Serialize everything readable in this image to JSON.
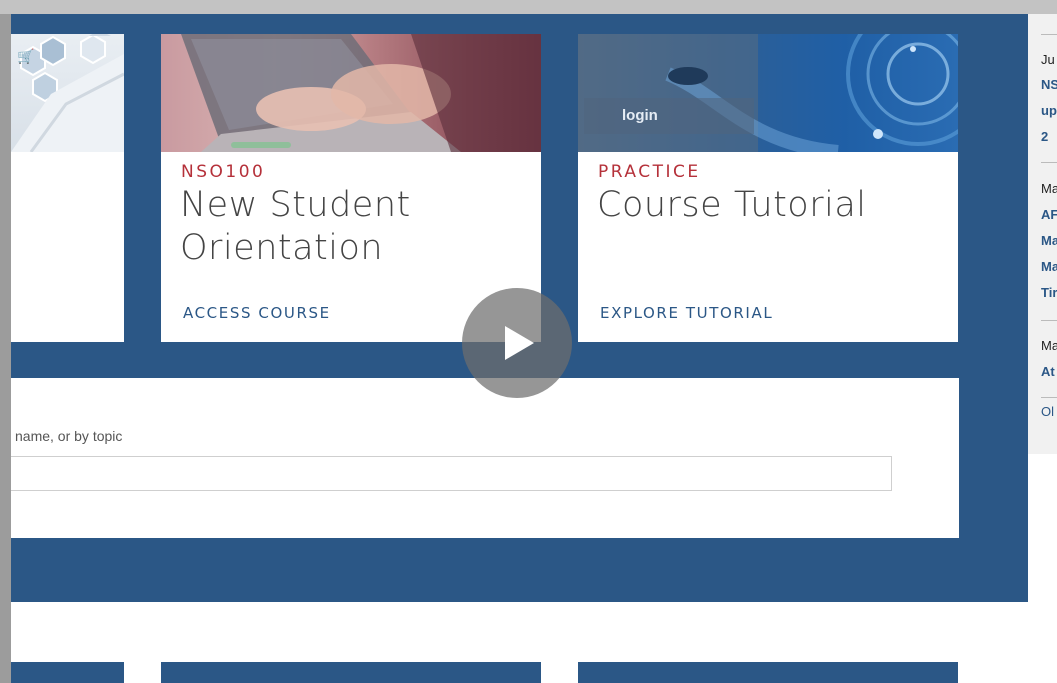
{
  "cards": [
    {
      "label": "NSO100",
      "title_line1": "New Student",
      "title_line2": "Orientation",
      "link": "ACCESS COURSE"
    },
    {
      "label": "PRACTICE",
      "title_line1": "Course Tutorial",
      "link": "EXPLORE TUTORIAL",
      "image_text": "login"
    }
  ],
  "search": {
    "hint": "name, or by topic",
    "value": ""
  },
  "right_panel": {
    "items": [
      {
        "text": "Ju",
        "type": "text"
      },
      {
        "text": "NS",
        "type": "link"
      },
      {
        "text": "up",
        "type": "link"
      },
      {
        "text": "2",
        "type": "link"
      },
      {
        "text": "Ma",
        "type": "text"
      },
      {
        "text": "AF",
        "type": "link"
      },
      {
        "text": "Ma",
        "type": "link"
      },
      {
        "text": "Ma",
        "type": "link"
      },
      {
        "text": "Tir",
        "type": "link"
      },
      {
        "text": "Ma",
        "type": "text"
      },
      {
        "text": "At",
        "type": "link"
      },
      {
        "text": "Ol",
        "type": "text"
      }
    ]
  },
  "colors": {
    "brand_blue": "#2b5786",
    "accent_red": "#b5313a"
  },
  "icons": [
    "play-icon",
    "shopping-cart-icon"
  ]
}
